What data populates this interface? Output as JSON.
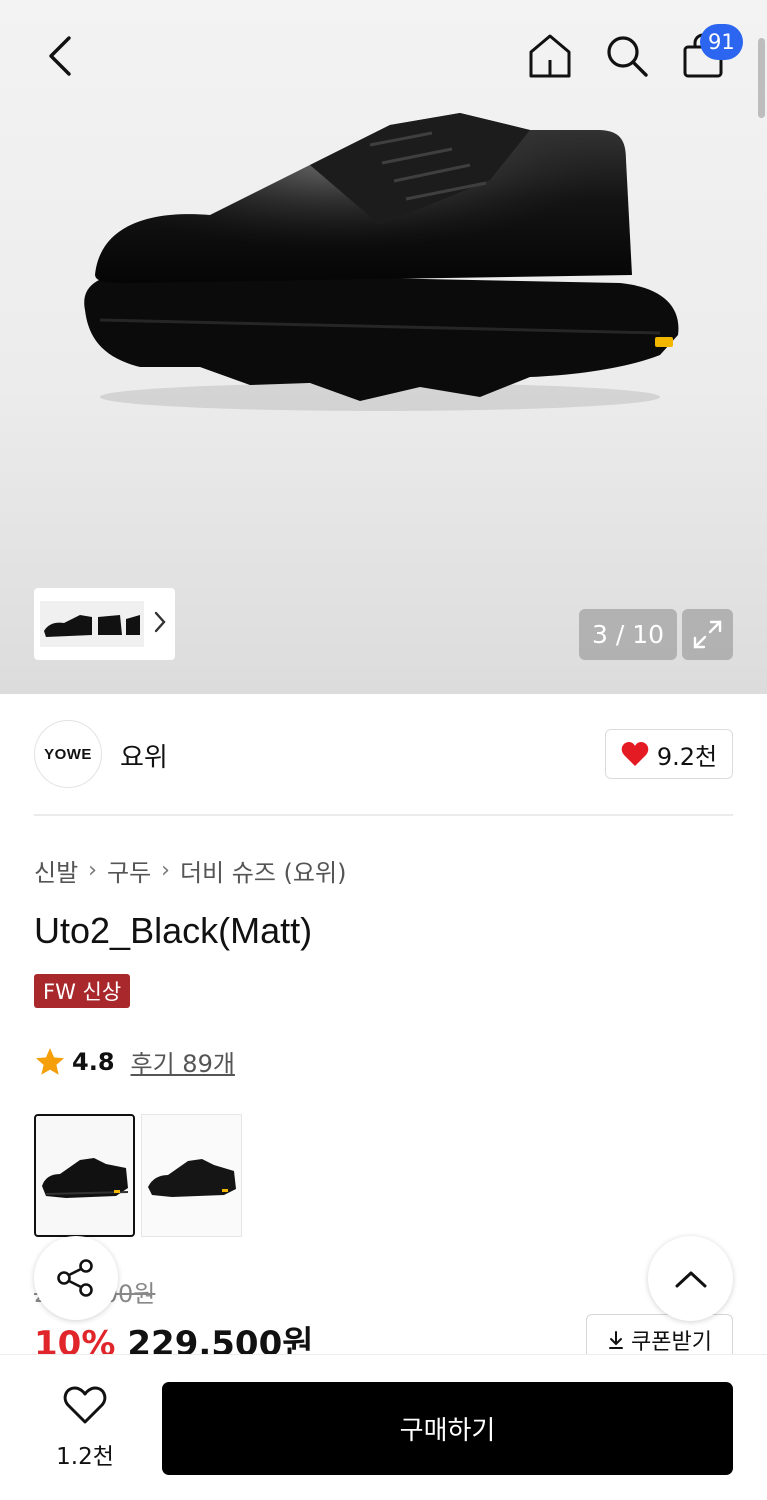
{
  "header": {
    "cart_count": "91",
    "icons": [
      "chevron-left-icon",
      "home-icon",
      "search-icon",
      "shopping-bag-icon"
    ]
  },
  "gallery": {
    "counter": "3 / 10"
  },
  "brand": {
    "logo_text": "YOWE",
    "name": "요위",
    "likes": "9.2천"
  },
  "breadcrumb": [
    "신발",
    "구두",
    "더비 슈즈 (요위)"
  ],
  "product": {
    "title": "Uto2_Black(Matt)",
    "tag": "FW 신상",
    "rating": "4.8",
    "review_label": "후기 89개",
    "original_price": "255,000원",
    "discount": "10%",
    "sale_price": "229,500원",
    "coupon_label": "쿠폰받기"
  },
  "bottom_bar": {
    "wish_count": "1.2천",
    "buy_label": "구매하기"
  },
  "colors": {
    "accent_badge": "#2c66f0",
    "sale_red": "#e0262b",
    "tag_red": "#a8282c",
    "heart_red": "#e51b23",
    "star": "#f5a00a"
  }
}
